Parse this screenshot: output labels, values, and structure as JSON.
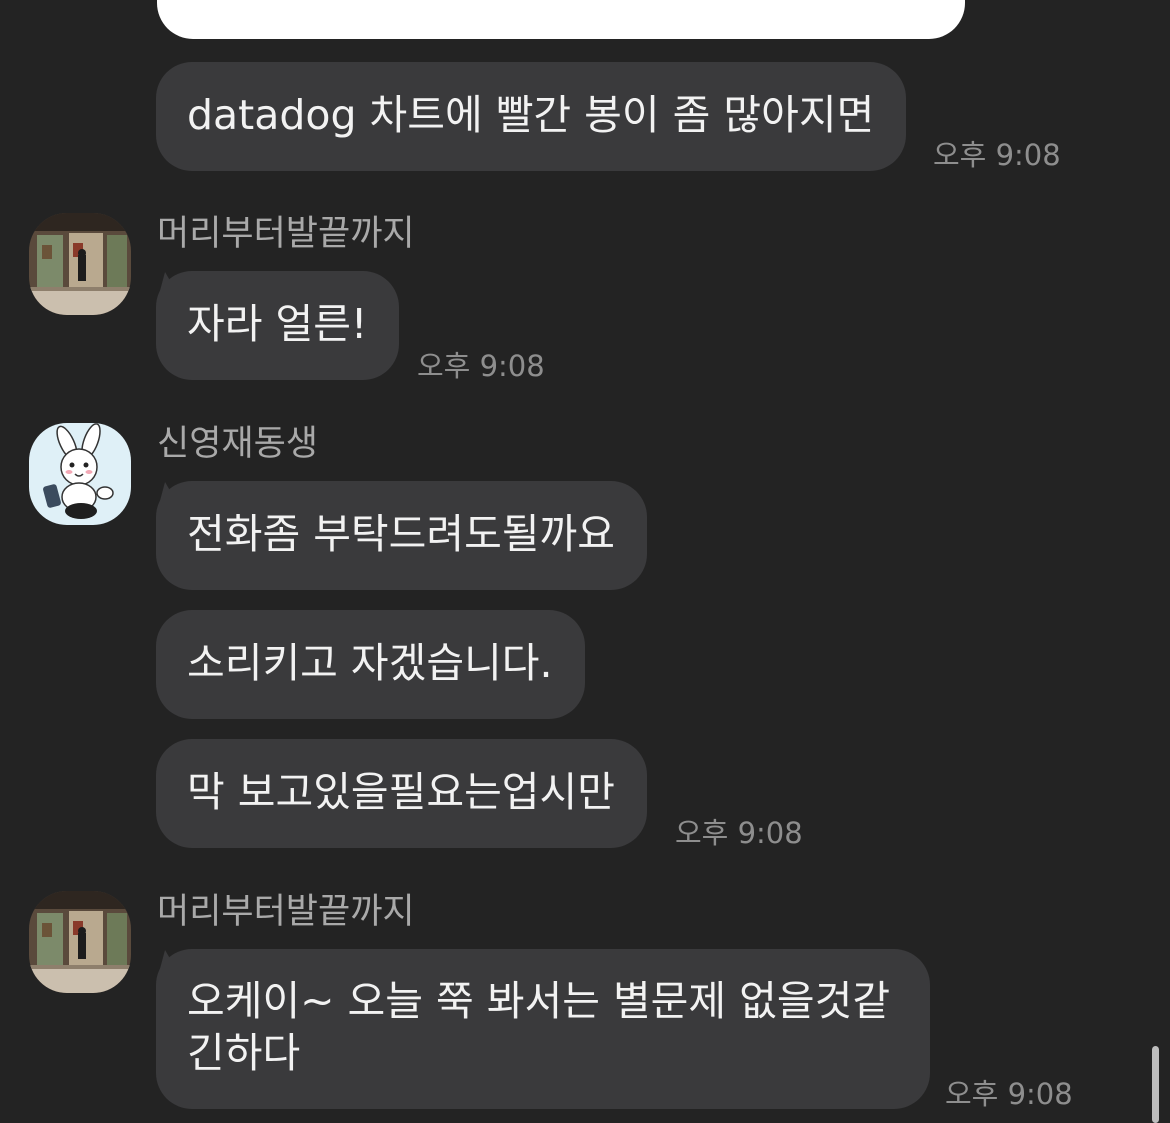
{
  "messages": [
    {
      "id": "m0",
      "text": "",
      "style": "white"
    },
    {
      "id": "m1",
      "text": "datadog 차트에 빨간 봉이 좀 많아지면",
      "time": "오후 9:08"
    },
    {
      "id": "m2",
      "sender": "머리부터발끝까지",
      "text": "자라 얼른!",
      "time": "오후 9:08"
    },
    {
      "id": "m3",
      "sender": "신영재동생",
      "text": "전화좀 부탁드려도될까요"
    },
    {
      "id": "m4",
      "text": "소리키고 자겠습니다."
    },
    {
      "id": "m5",
      "text": "막 보고있을필요는업시만",
      "time": "오후 9:08"
    },
    {
      "id": "m6",
      "sender": "머리부터발끝까지",
      "text_line1": "오케이~ 오늘 쭉 봐서는 별문제 없을것같",
      "text_line2": "긴하다",
      "time": "오후 9:08"
    }
  ],
  "avatars": {
    "gallery": "gallery-photo-avatar",
    "rabbit": "rabbit-cartoon-avatar"
  },
  "colors": {
    "background": "#232323",
    "bubble": "#3a3a3c",
    "text": "#f2f2f2",
    "meta": "#8e8e8e"
  }
}
